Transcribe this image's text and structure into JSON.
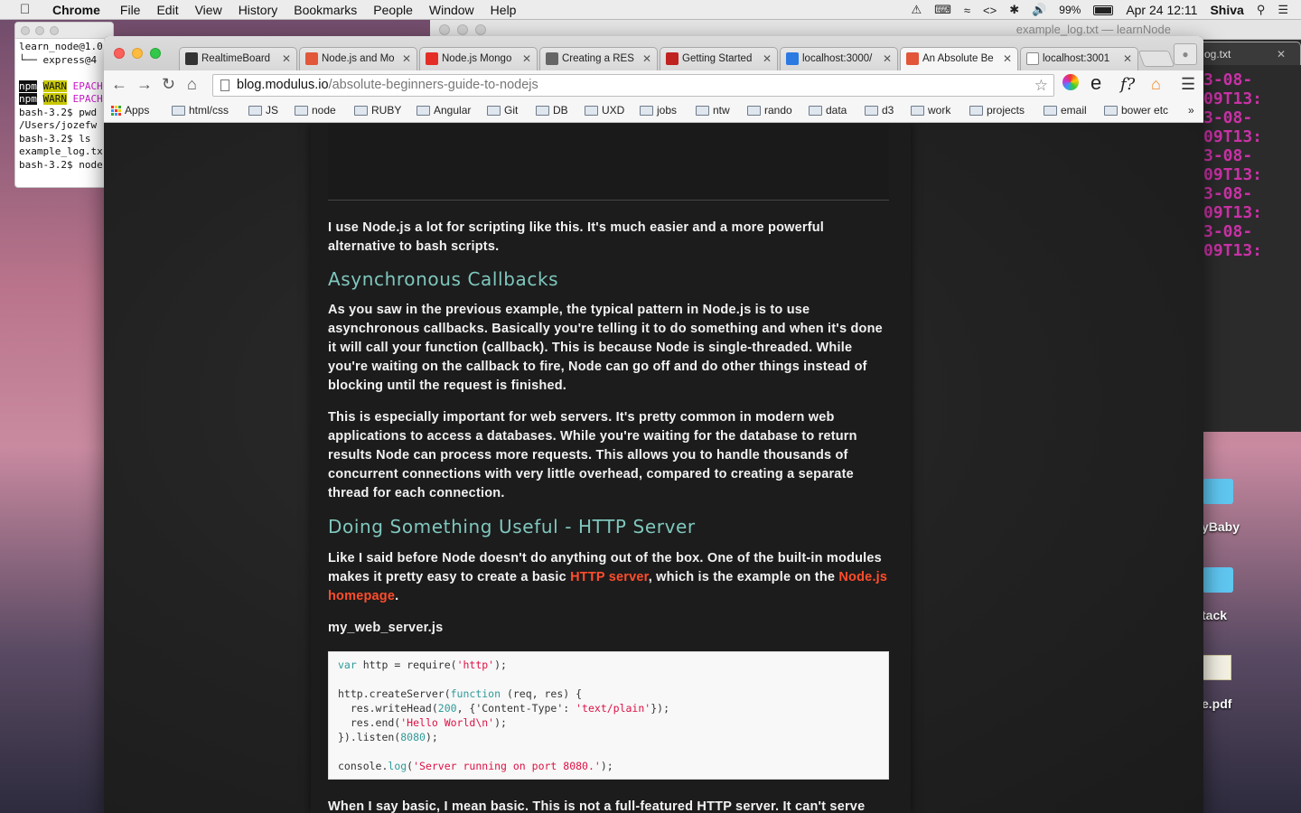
{
  "menubar": {
    "app": "Chrome",
    "items": [
      "File",
      "Edit",
      "View",
      "History",
      "Bookmarks",
      "People",
      "Window",
      "Help"
    ],
    "battery": "99%",
    "clock": "Apr 24  12:11",
    "user": "Shiva"
  },
  "bg_editor": {
    "title": "example_log.txt — learnNode",
    "tab": "og.txt",
    "lines": [
      "3-08-09T13:",
      "3-08-09T13:",
      "3-08-09T13:",
      "3-08-09T13:",
      "3-08-09T13:"
    ]
  },
  "terminal": {
    "line1": "learn_node@1.0",
    "line2": "└── express@4",
    "npm": "npm",
    "warn": "WARN",
    "epac": "EPACH",
    "line5": "bash-3.2$ pwd",
    "line6": "/Users/jozefw",
    "line7": "bash-3.2$ ls",
    "line8": "example_log.tx",
    "line9": "bash-3.2$ node"
  },
  "desktop": {
    "icons": [
      "yBaby",
      "tack",
      "e.pdf"
    ]
  },
  "tabs": [
    {
      "label": "RealtimeBoard",
      "color": "#333333"
    },
    {
      "label": "Node.js and Mo",
      "color": "#e2563a"
    },
    {
      "label": "Node.js Mongo",
      "color": "#e52d27"
    },
    {
      "label": "Creating a RES",
      "color": "#666666"
    },
    {
      "label": "Getting Started",
      "color": "#c0221f"
    },
    {
      "label": "localhost:3000/",
      "color": "#2a7ae2"
    },
    {
      "label": "An Absolute Be",
      "color": "#e2563a"
    },
    {
      "label": "localhost:3001",
      "color": "#888888"
    }
  ],
  "omnibox": {
    "host": "blog.modulus.io",
    "path": "/absolute-beginners-guide-to-nodejs"
  },
  "bookmarks": [
    "Apps",
    "html/css",
    "JS",
    "node",
    "RUBY",
    "Angular",
    "Git",
    "DB",
    "UXD",
    "jobs",
    "ntw",
    "rando",
    "data",
    "d3",
    "work",
    "projects",
    "email",
    "bower etc"
  ],
  "article": {
    "p1": "I use Node.js a lot for scripting like this. It's much easier and a more powerful alternative to bash scripts.",
    "h_async": "Asynchronous Callbacks",
    "p2": "As you saw in the previous example, the typical pattern in Node.js is to use asynchronous callbacks. Basically you're telling it to do something and when it's done it will call your function (callback). This is because Node is single-threaded. While you're waiting on the callback to fire, Node can go off and do other things instead of blocking until the request is finished.",
    "p3": "This is especially important for web servers. It's pretty common in modern web applications to access a databases. While you're waiting for the database to return results Node can process more requests. This allows you to handle thousands of concurrent connections with very little overhead, compared to creating a separate thread for each connection.",
    "h_http": "Doing Something Useful - HTTP Server",
    "p4_before": "Like I said before Node doesn't do anything out of the box. One of the built-in modules makes it pretty easy to create a basic ",
    "p4_link1": "HTTP server",
    "p4_mid": ", which is the example on the ",
    "p4_link2": "Node.js homepage",
    "p4_after": ".",
    "filename": "my_web_server.js",
    "code": {
      "l1_kw": "var",
      "l1_a": " http = require(",
      "l1_s": "'http'",
      "l1_b": ");",
      "l3_a": "http.createServer(",
      "l3_kw": "function",
      "l3_b": " (req, res) {",
      "l4_a": "  res.writeHead(",
      "l4_n": "200",
      "l4_b": ", {'Content-Type': ",
      "l4_s": "'text/plain'",
      "l4_c": "});",
      "l5_a": "  res.end(",
      "l5_s": "'Hello World\\n'",
      "l5_b": ");",
      "l6_a": "}).listen(",
      "l6_n": "8080",
      "l6_b": ");",
      "l8_a": "console.",
      "l8_kw": "log",
      "l8_b": "(",
      "l8_s": "'Server running on port 8080.'",
      "l8_c": ");"
    },
    "p5": "When I say basic, I mean basic. This is not a full-featured HTTP server. It can't serve"
  }
}
